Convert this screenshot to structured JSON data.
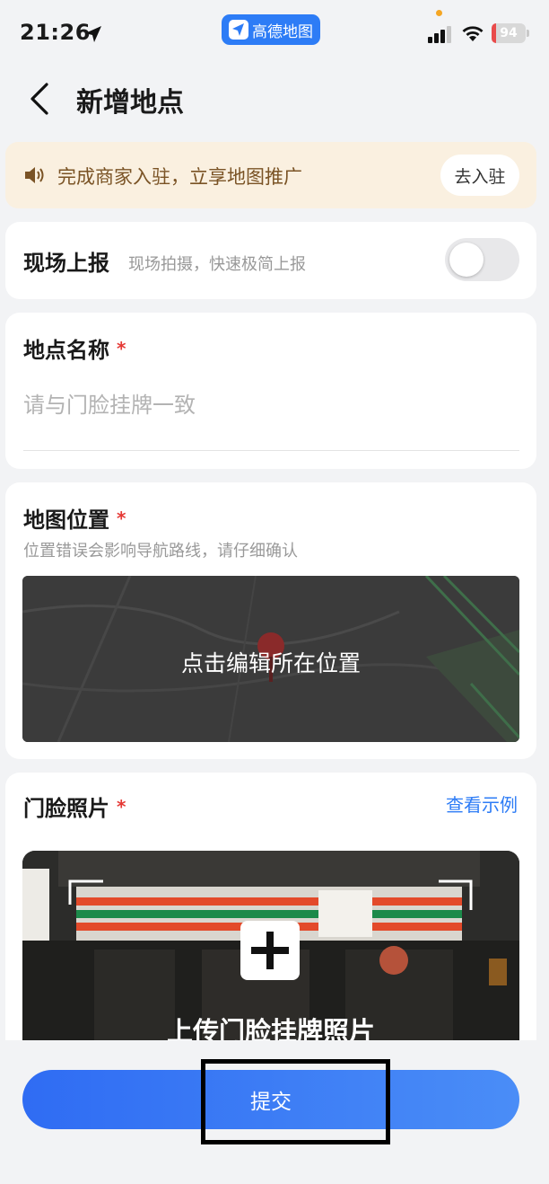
{
  "status_bar": {
    "time": "21:26",
    "app_name": "高德地图",
    "battery": "94"
  },
  "header": {
    "title": "新增地点"
  },
  "banner": {
    "text": "完成商家入驻，立享地图推广",
    "button": "去入驻"
  },
  "onsite_report": {
    "title": "现场上报",
    "subtitle": "现场拍摄，快速极简上报",
    "enabled": false
  },
  "place_name": {
    "title": "地点名称",
    "required_mark": "*",
    "placeholder": "请与门脸挂牌一致",
    "value": ""
  },
  "map_location": {
    "title": "地图位置",
    "required_mark": "*",
    "description": "位置错误会影响导航路线，请仔细确认",
    "overlay_label": "点击编辑所在位置"
  },
  "storefront_photo": {
    "title": "门脸照片",
    "required_mark": "*",
    "example_link": "查看示例",
    "upload_label": "上传门脸挂牌照片"
  },
  "submit": {
    "label": "提交"
  },
  "colors": {
    "accent": "#2d7cf6",
    "required": "#e53935",
    "banner_bg": "#faf0e0",
    "banner_text": "#7a5325"
  }
}
